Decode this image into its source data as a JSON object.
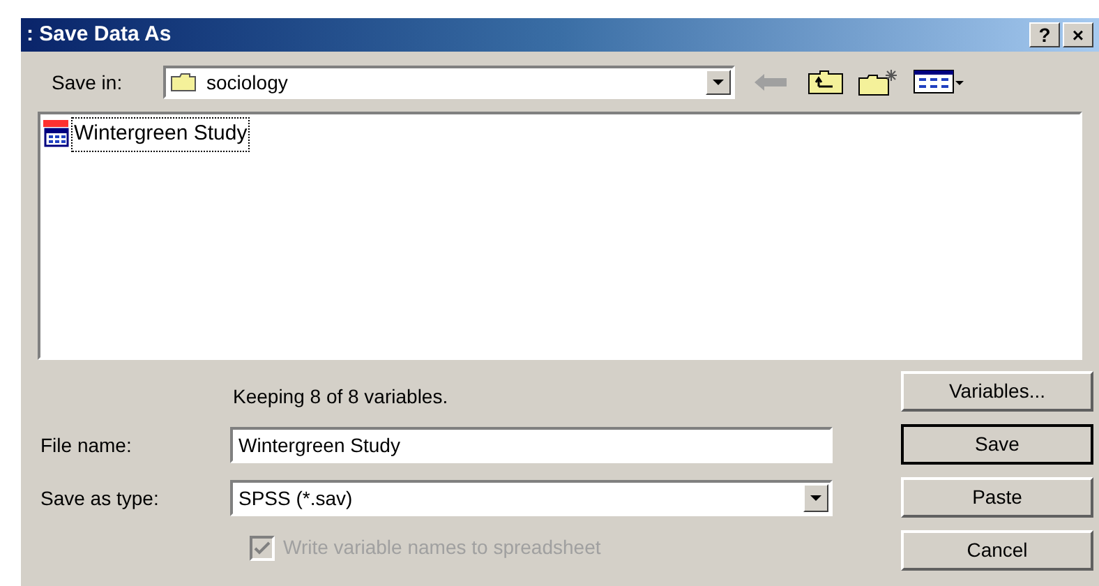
{
  "window": {
    "title": ": Save Data As",
    "controls": [
      "?",
      "×"
    ]
  },
  "save_in": {
    "label": "Save in:",
    "value": "sociology"
  },
  "files": [
    {
      "name": "Wintergreen Study",
      "selected": true
    }
  ],
  "status": "Keeping 8 of 8 variables.",
  "file_name": {
    "label": "File name:",
    "value": "Wintergreen Study"
  },
  "save_as_type": {
    "label": "Save as type:",
    "value": "SPSS (*.sav)"
  },
  "write_names": {
    "label": "Write variable names to spreadsheet",
    "checked": true,
    "disabled": true
  },
  "buttons": [
    {
      "label": "Variables...",
      "default": false
    },
    {
      "label": "Save",
      "default": true
    },
    {
      "label": "Paste",
      "default": false
    },
    {
      "label": "Cancel",
      "default": false
    }
  ]
}
